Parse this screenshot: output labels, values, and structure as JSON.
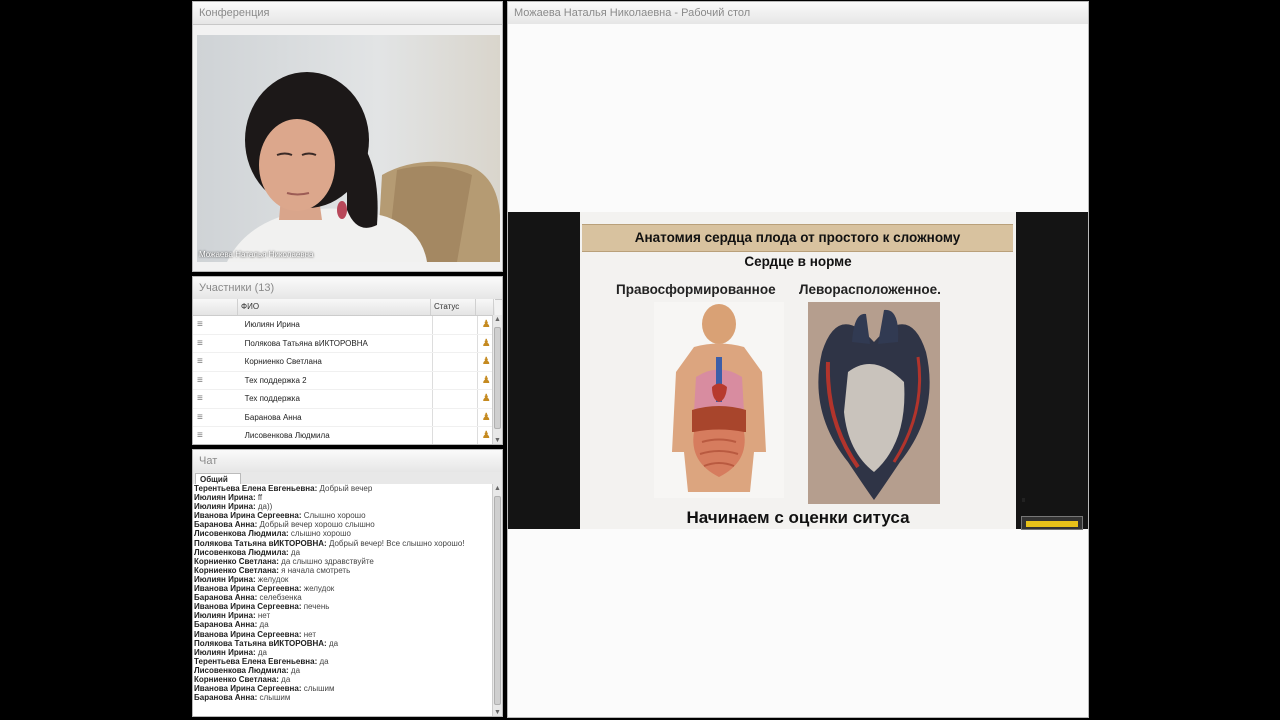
{
  "conference": {
    "title": "Конференция",
    "video_caption": "Можаева Наталья  Николаевна"
  },
  "participants": {
    "title": "Участники (13)",
    "columns": [
      "",
      "ФИО",
      "Статус",
      ""
    ],
    "rows": [
      {
        "name": "Июлиян Ирина"
      },
      {
        "name": "Полякова Татьяна вИКТОРОВНА"
      },
      {
        "name": "Корниенко Светлана"
      },
      {
        "name": "Тех поддержка 2"
      },
      {
        "name": "Тех поддержка"
      },
      {
        "name": "Баранова Анна"
      },
      {
        "name": "Лисовенкова Людмила"
      }
    ]
  },
  "chat": {
    "title": "Чат",
    "tab": "Общий",
    "messages": [
      {
        "author": "Терентьева Елена  Евгеньевна:",
        "text": "Добрый вечер"
      },
      {
        "author": "Июлиян Ирина:",
        "text": "ff"
      },
      {
        "author": "Июлиян Ирина:",
        "text": "да))"
      },
      {
        "author": "Иванова Ирина  Сергеевна:",
        "text": "Слышно хорошо"
      },
      {
        "author": "Баранова Анна:",
        "text": "Добрый вечер хорошо слышно"
      },
      {
        "author": "Лисовенкова Людмила:",
        "text": "слышно хорошо"
      },
      {
        "author": "Полякова Татьяна вИКТОРОВНА:",
        "text": "Добрый вечер! Все слышно хорошо!"
      },
      {
        "author": "Лисовенкова Людмила:",
        "text": "да"
      },
      {
        "author": "Корниенко Светлана:",
        "text": "да слышно здравствуйте"
      },
      {
        "author": "Корниенко Светлана:",
        "text": "я начала смотреть"
      },
      {
        "author": "Июлиян Ирина:",
        "text": "желудок"
      },
      {
        "author": "Иванова Ирина  Сергеевна:",
        "text": "желудок"
      },
      {
        "author": "Баранова Анна:",
        "text": "селебзенка"
      },
      {
        "author": "Иванова Ирина  Сергеевна:",
        "text": "печень"
      },
      {
        "author": "Июлиян Ирина:",
        "text": "нет"
      },
      {
        "author": "Баранова Анна:",
        "text": "да"
      },
      {
        "author": "Иванова Ирина  Сергеевна:",
        "text": "нет"
      },
      {
        "author": "Полякова Татьяна вИКТОРОВНА:",
        "text": "да"
      },
      {
        "author": "Июлиян Ирина:",
        "text": "да"
      },
      {
        "author": "Терентьева Елена  Евгеньевна:",
        "text": "да"
      },
      {
        "author": "Лисовенкова Людмила:",
        "text": "да"
      },
      {
        "author": "Корниенко Светлана:",
        "text": "да"
      },
      {
        "author": "Иванова Ирина  Сергеевна:",
        "text": "слышим"
      },
      {
        "author": "Баранова Анна:",
        "text": "слышим"
      }
    ]
  },
  "desktop": {
    "title": "Можаева Наталья  Николаевна - Рабочий стол"
  },
  "slide": {
    "title": "Анатомия сердца плода от простого к сложному",
    "subtitle": "Сердце в норме",
    "left_label": "Правосформированное",
    "right_label": "Леворасположенное.",
    "bottom": "Начинаем  с оценки ситуса"
  },
  "colors": {
    "panel_bg": "#f2f2f2",
    "slide_title_bar": "#d8c29f",
    "user_icon": "#c58a20"
  }
}
